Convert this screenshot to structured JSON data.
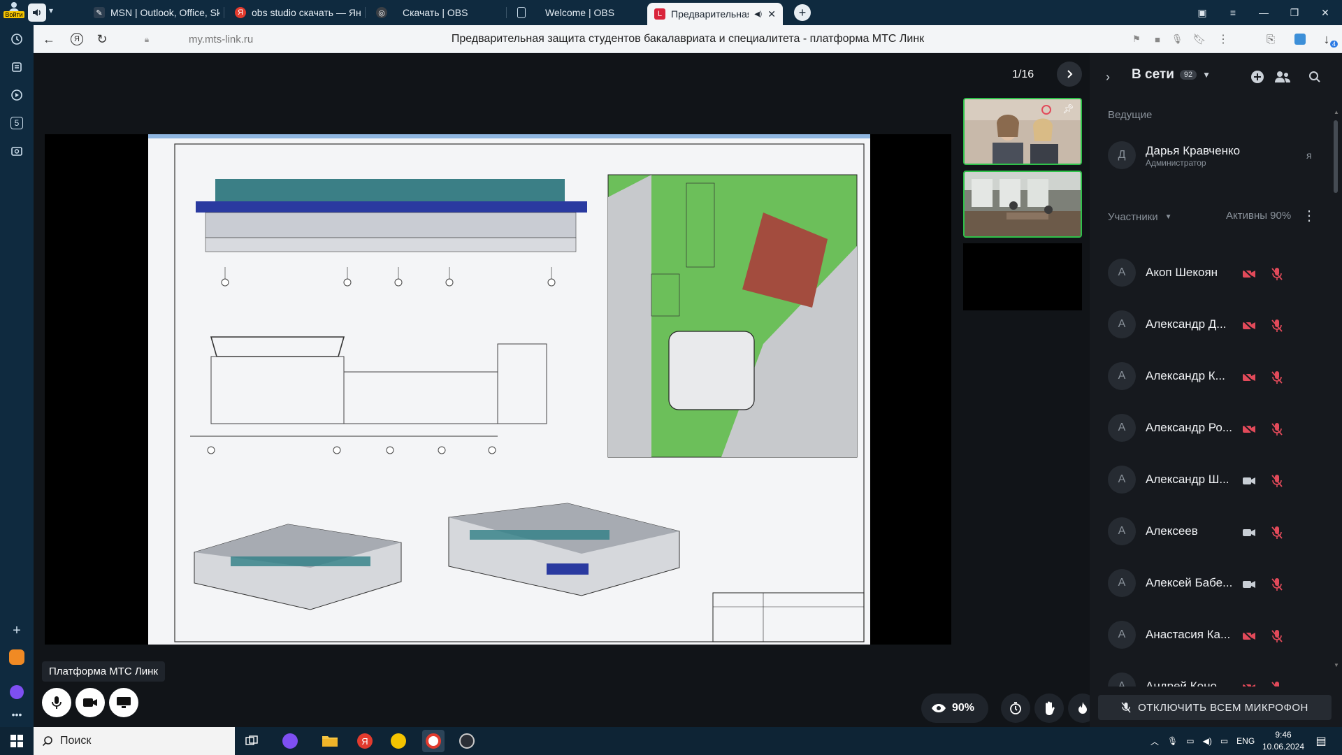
{
  "browser": {
    "login_label": "Войти",
    "tabs": [
      {
        "label": "MSN | Outlook, Office, Sky"
      },
      {
        "label": "obs studio скачать — Янд"
      },
      {
        "label": "Скачать | OBS"
      },
      {
        "label": "Welcome | OBS"
      },
      {
        "label": "Предварительная з"
      }
    ],
    "url": "my.mts-link.ru",
    "page_title": "Предварительная защита студентов бакалавриата и специалитета - платформа МТС Линк",
    "sidebar_badge": "5",
    "ext_badge": "4"
  },
  "presentation": {
    "page_counter": "1/16"
  },
  "controls": {
    "tooltip": "Платформа МТС Линк",
    "attention": "90%"
  },
  "panel": {
    "header_title": "В сети",
    "online_count": "92",
    "hosts_label": "Ведущие",
    "host": {
      "initial": "Д",
      "name": "Дарья Кравченко",
      "role": "Администратор",
      "me": "я"
    },
    "participants_label": "Участники",
    "active_label": "Активны 90%",
    "participants": [
      {
        "initial": "А",
        "name": "Акоп Шекоян",
        "camera": "off"
      },
      {
        "initial": "А",
        "name": "Александр Д...",
        "camera": "off"
      },
      {
        "initial": "А",
        "name": "Александр К...",
        "camera": "off"
      },
      {
        "initial": "А",
        "name": "Александр Ро...",
        "camera": "off"
      },
      {
        "initial": "А",
        "name": "Александр Ш...",
        "camera": "on"
      },
      {
        "initial": "А",
        "name": "Алексеев",
        "camera": "on"
      },
      {
        "initial": "А",
        "name": "Алексей Бабе...",
        "camera": "on"
      },
      {
        "initial": "А",
        "name": "Анастасия Ка...",
        "camera": "off"
      },
      {
        "initial": "А",
        "name": "Андрей Коно...",
        "camera": "off"
      }
    ],
    "mute_all_label": "ОТКЛЮЧИТЬ ВСЕМ МИКРОФОН"
  },
  "taskbar": {
    "search_placeholder": "Поиск",
    "lang": "ENG",
    "time": "9:46",
    "date": "10.06.2024"
  },
  "colors": {
    "accent_green": "#2fc24a",
    "mute_red": "#e24a5a",
    "tab_bar": "#0f2a3f",
    "panel_bg": "#16191e"
  }
}
